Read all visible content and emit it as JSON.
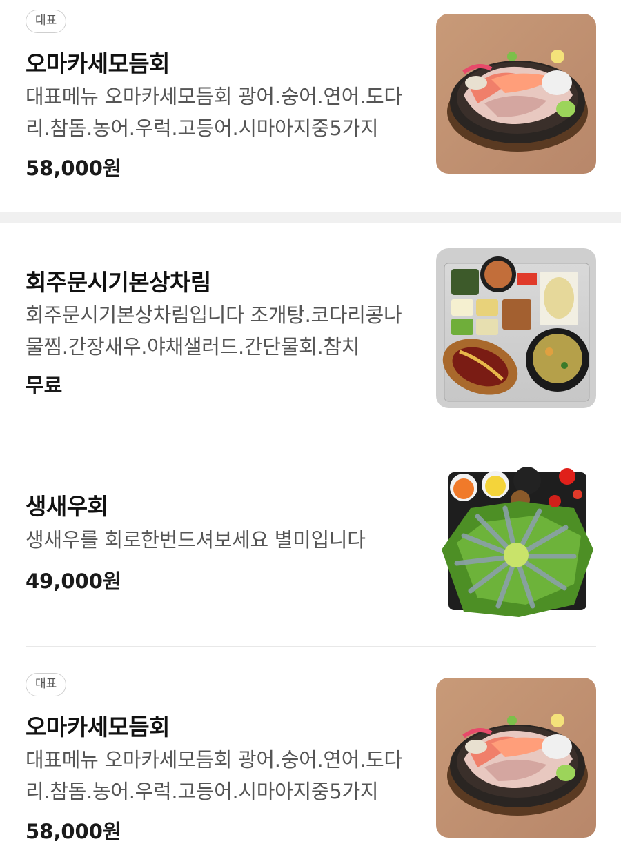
{
  "items": [
    {
      "badge": "대표",
      "name": "오마카세모듬회",
      "description": "대표메뉴 오마카세모듬회 광어.숭어.연어.도다리.참돔.농어.우럭.고등어.시마아지중5가지",
      "price": "58,000원",
      "image_icon": "sashimi-platter-image"
    },
    {
      "name": "회주문시기본상차림",
      "description": "회주문시기본상차림입니다 조개탕.코다리콩나물찜.간장새우.야채샐러드.간단물회.참치",
      "price": "무료",
      "image_icon": "side-dishes-image"
    },
    {
      "name": "생새우회",
      "description": "생새우를 회로한번드셔보세요 별미입니다",
      "price": "49,000원",
      "image_icon": "raw-shrimp-image"
    },
    {
      "badge": "대표",
      "name": "오마카세모듬회",
      "description": "대표메뉴 오마카세모듬회 광어.숭어.연어.도다리.참돔.농어.우럭.고등어.시마아지중5가지",
      "price": "58,000원",
      "image_icon": "sashimi-platter-image"
    }
  ]
}
